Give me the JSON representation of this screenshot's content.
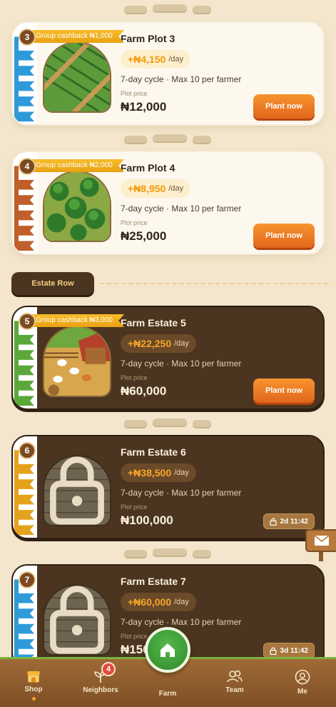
{
  "sections": {
    "estate_row_label": "Estate Row"
  },
  "plots": [
    {
      "number": "3",
      "cashback": "Group cashback ₦1,000",
      "title": "Farm Plot 3",
      "rate": "+₦4,150",
      "rate_unit": "/day",
      "cycle": "7-day cycle · Max 10 per farmer",
      "price_label": "Plot price",
      "price": "₦12,000",
      "action": "Plant now",
      "ribbon_color": "#2e9ad9",
      "thumbnail": "crop-field"
    },
    {
      "number": "4",
      "cashback": "Group cashback ₦2,000",
      "title": "Farm Plot 4",
      "rate": "+₦8,950",
      "rate_unit": "/day",
      "cycle": "7-day cycle · Max 10 per farmer",
      "price_label": "Plot price",
      "price": "₦25,000",
      "action": "Plant now",
      "ribbon_color": "#c15f2b",
      "thumbnail": "tree-grove"
    },
    {
      "number": "5",
      "cashback": "Group cashback ₦3,000",
      "title": "Farm Estate 5",
      "rate": "+₦22,250",
      "rate_unit": "/day",
      "cycle": "7-day cycle · Max 10 per farmer",
      "price_label": "Plot price",
      "price": "₦60,000",
      "action": "Plant now",
      "ribbon_color": "#5aa83a",
      "thumbnail": "chicken-coop"
    },
    {
      "number": "6",
      "title": "Farm Estate 6",
      "rate": "+₦38,500",
      "rate_unit": "/day",
      "cycle": "7-day cycle · Max 10 per farmer",
      "price_label": "Plot price",
      "price": "₦100,000",
      "timer": "2d 11:42",
      "ribbon_color": "#e5a21c",
      "thumbnail": "locked-plot"
    },
    {
      "number": "7",
      "title": "Farm Estate 7",
      "rate": "+₦60,000",
      "rate_unit": "/day",
      "cycle": "7-day cycle · Max 10 per farmer",
      "price_label": "Plot price",
      "price": "₦150,000",
      "timer": "3d 11:42",
      "ribbon_color": "#2e9ad9",
      "thumbnail": "locked-plot"
    }
  ],
  "nav": {
    "shop": "Shop",
    "neighbors": "Neighbors",
    "neighbors_badge": "4",
    "farm": "Farm",
    "team": "Team",
    "me": "Me",
    "active": "Shop"
  },
  "icons": {
    "lock": "lock-icon",
    "clock": "timer-lock-icon",
    "mail": "mail-sign-icon"
  },
  "colors": {
    "accent_orange": "#e8701f",
    "rate_orange": "#f39a0f",
    "dark_card": "#4b3520",
    "nav_brown": "#8f5d2e",
    "farm_green": "#3a9a34"
  }
}
